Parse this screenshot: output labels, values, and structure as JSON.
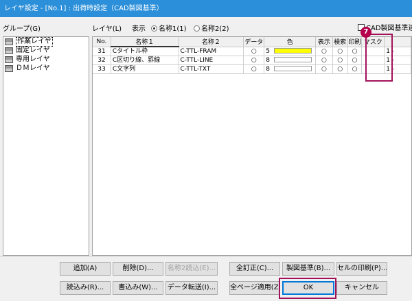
{
  "window": {
    "title": "レイヤ設定 - [No.1] : 出荷時設定（CAD製図基準）"
  },
  "group": {
    "label": "グループ(G)",
    "items": [
      {
        "label": "作業レイヤ",
        "selected": true
      },
      {
        "label": "固定レイヤ"
      },
      {
        "label": "専用レイヤ"
      },
      {
        "label": "ＤＭレイヤ"
      }
    ]
  },
  "layer": {
    "label": "レイヤ(L)",
    "display_label": "表示",
    "radio_name1": "名称1(1)",
    "radio_name2": "名称2(2)",
    "cad_checkbox_label": "CAD製図基準連動"
  },
  "table": {
    "headers": [
      "No.",
      "名称１",
      "名称２",
      "データ",
      "色",
      "表示",
      "検索",
      "印刷",
      "マスク",
      ""
    ],
    "rows": [
      {
        "no": "31",
        "name1": "Cタイトル枠",
        "name2": "C-TTL-FRAM",
        "data": "○",
        "color_num": "5",
        "color": "#ffff00",
        "show": "○",
        "search": "○",
        "print": "○",
        "mask": "",
        "extra": "1 -"
      },
      {
        "no": "32",
        "name1": "C区切り線、罫線",
        "name2": "C-TTL-LINE",
        "data": "○",
        "color_num": "8",
        "color": "#ffffff",
        "show": "○",
        "search": "○",
        "print": "○",
        "mask": "",
        "extra": "1 -"
      },
      {
        "no": "33",
        "name1": "C文字列",
        "name2": "C-TTL-TXT",
        "data": "○",
        "color_num": "8",
        "color": "#ffffff",
        "show": "○",
        "search": "○",
        "print": "○",
        "mask": "",
        "extra": "1 -"
      }
    ]
  },
  "badge": "7",
  "buttons": {
    "add": "追加(A)",
    "delete": "削除(D)...",
    "name2_read": "名称2読込(E)...",
    "all_fix": "全訂正(C)...",
    "drafting_std": "製図基準(B)...",
    "cell_print": "セルの印刷(P)...",
    "load": "読込み(R)...",
    "save": "書込み(W)...",
    "data_transfer": "データ転送(I)...",
    "all_page_apply": "全ページ適用(Z)",
    "ok": "OK",
    "cancel": "キャンセル"
  },
  "colors": {
    "highlight": "#a2125a",
    "badge": "#b5004b",
    "titlebar": "#2b8fd9"
  }
}
